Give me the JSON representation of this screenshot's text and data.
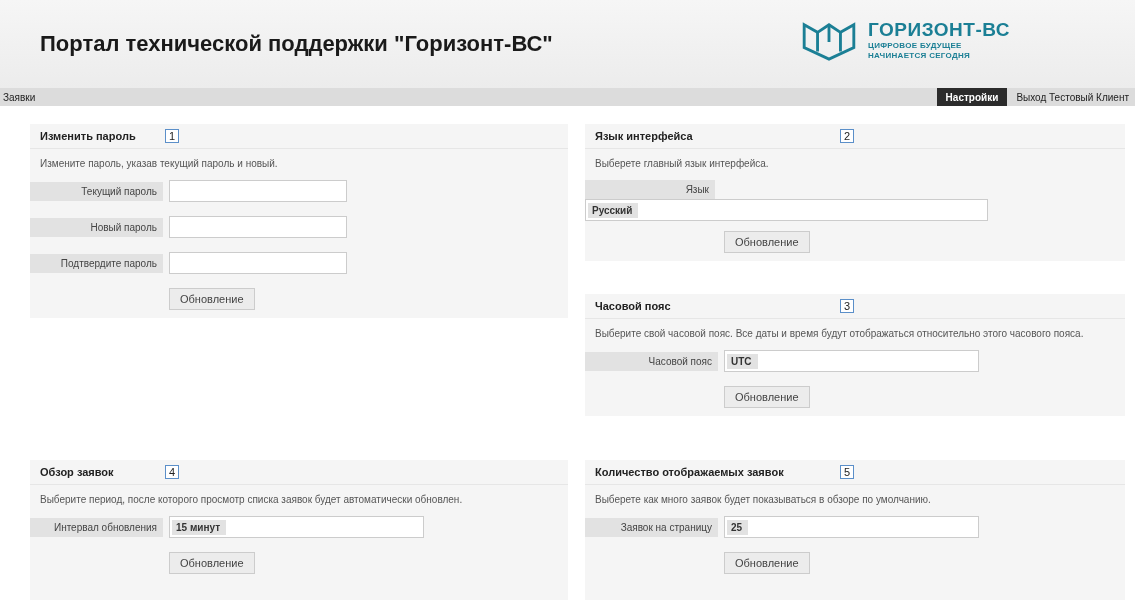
{
  "header": {
    "title": "Портал технической поддержки \"Горизонт-ВС\"",
    "logo": {
      "name": "ГОРИЗОНТ-ВС",
      "tagline": [
        "ЦИФРОВОЕ БУДУЩЕЕ",
        "НАЧИНАЕТСЯ СЕГОДНЯ"
      ]
    }
  },
  "nav": {
    "left": [
      {
        "label": "Заявки",
        "selected": false
      }
    ],
    "right": [
      {
        "label": "Настройки",
        "selected": true
      },
      {
        "label": "Выход Тестовый Клиент",
        "selected": false
      }
    ]
  },
  "panels": [
    {
      "title": "Изменить пароль",
      "marker": "1",
      "description": "Измените пароль, указав текущий пароль и новый.",
      "fields": [
        {
          "kind": "input",
          "label": "Текущий пароль"
        },
        {
          "kind": "input",
          "label": "Новый пароль"
        },
        {
          "kind": "input",
          "label": "Подтвердите пароль"
        }
      ],
      "button": "Обновление"
    },
    {
      "title": "Язык интерфейса",
      "marker": "2",
      "description": "Выберете главный язык интерфейса.",
      "fields": [
        {
          "kind": "select_stacked",
          "label": "Язык",
          "value": "Русский"
        }
      ],
      "button": "Обновление"
    },
    {
      "title": "Часовой пояс",
      "marker": "3",
      "description": "Выберите свой часовой пояс. Все даты и время будут отображаться относительно этого часового пояса.",
      "fields": [
        {
          "kind": "select",
          "label": "Часовой пояс",
          "value": "UTC"
        }
      ],
      "button": "Обновление"
    },
    {
      "title": "Обзор заявок",
      "marker": "4",
      "description": "Выберите период, после которого просмотр списка заявок будет автоматически обновлен.",
      "fields": [
        {
          "kind": "select",
          "label": "Интервал обновления",
          "value": "15 минут"
        }
      ],
      "button": "Обновление"
    },
    {
      "title": "Количество отображаемых заявок",
      "marker": "5",
      "description": "Выберете как много заявок будет показываться в обзоре по умолчанию.",
      "fields": [
        {
          "kind": "select",
          "label": "Заявок на страницу",
          "value": "25"
        }
      ],
      "button": "Обновление"
    }
  ]
}
